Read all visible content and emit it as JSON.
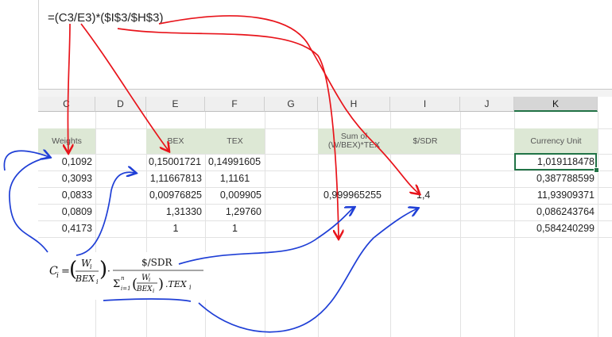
{
  "formula_bar": {
    "text": "=(C3/E3)*($I$3/$H$3)"
  },
  "columns": [
    {
      "id": "C",
      "label": "C"
    },
    {
      "id": "D",
      "label": "D"
    },
    {
      "id": "E",
      "label": "E"
    },
    {
      "id": "F",
      "label": "F"
    },
    {
      "id": "G",
      "label": "G"
    },
    {
      "id": "H",
      "label": "H"
    },
    {
      "id": "I",
      "label": "I"
    },
    {
      "id": "J",
      "label": "J"
    },
    {
      "id": "K",
      "label": "K"
    }
  ],
  "headers": {
    "weights": "Weights",
    "bex": "BEX",
    "tex": "TEX",
    "sum_line1": "Sum of",
    "sum_line2": "(W/BEX)*TEX",
    "usd_sdr": "$/SDR",
    "currency_unit": "Currency Unit"
  },
  "rows": [
    {
      "weights": "0,1092",
      "bex": "0,15001721",
      "tex": "0,14991605",
      "currency": "1,019118478"
    },
    {
      "weights": "0,3093",
      "bex": "1,11667813",
      "tex": "1,1161",
      "currency": "0,387788599"
    },
    {
      "weights": "0,0833",
      "bex": "0,00976825",
      "tex": "0,009905",
      "currency": "11,93909371"
    },
    {
      "weights": "0,0809",
      "bex": "1,31330",
      "tex": "1,29760",
      "currency": "0,086243764"
    },
    {
      "weights": "0,4173",
      "bex": "1",
      "tex": "1",
      "currency": "0,584240299"
    }
  ],
  "sum_value": "0,999965255",
  "usd_sdr_value": "1,4",
  "equation": {
    "lhs": "C",
    "lhs_sub": "i",
    "w": "W",
    "bex": "BEX",
    "i": "i",
    "numerator": "$/SDR",
    "sigma": "Σ",
    "sum_lower": "i=1",
    "sum_upper": "n",
    "tex": ".TEX"
  },
  "colors": {
    "annotation_red": "#e8141b",
    "annotation_blue": "#1f3fd6",
    "header_green": "#dde8d5",
    "selection_green": "#217346"
  }
}
